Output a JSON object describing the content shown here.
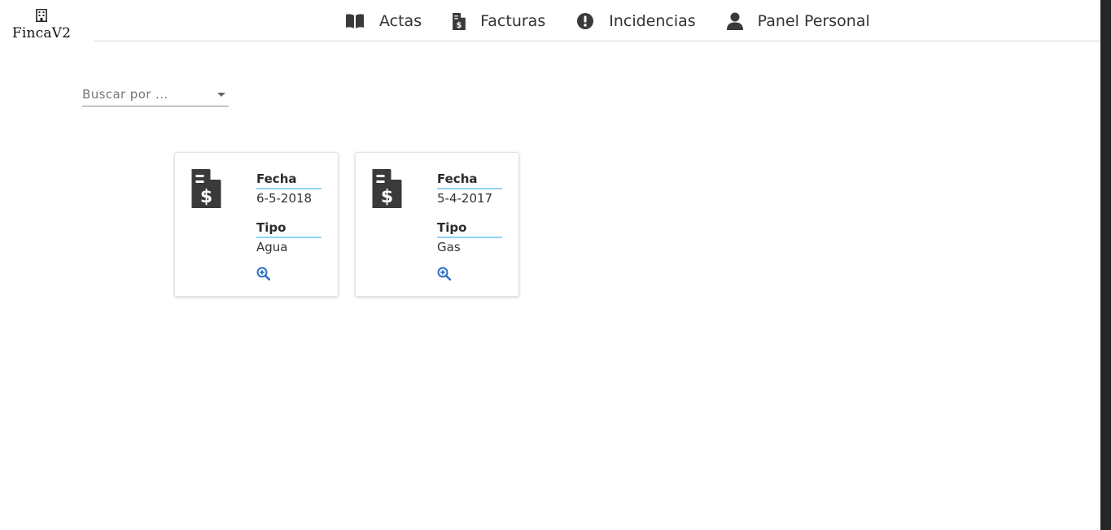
{
  "brand": {
    "name": "FincaV2",
    "icon": "building-icon"
  },
  "nav": {
    "items": [
      {
        "label": "Actas",
        "icon": "book-icon"
      },
      {
        "label": "Facturas",
        "icon": "invoice-file-icon"
      },
      {
        "label": "Incidencias",
        "icon": "exclamation-circle-icon"
      },
      {
        "label": "Panel Personal",
        "icon": "user-icon"
      }
    ]
  },
  "search": {
    "placeholder": "Buscar por ..."
  },
  "cards": [
    {
      "icon": "invoice-file-icon",
      "fecha_label": "Fecha",
      "fecha": "6-5-2018",
      "tipo_label": "Tipo",
      "tipo": "Agua",
      "action_icon": "zoom-in-icon"
    },
    {
      "icon": "invoice-file-icon",
      "fecha_label": "Fecha",
      "fecha": "5-4-2017",
      "tipo_label": "Tipo",
      "tipo": "Gas",
      "action_icon": "zoom-in-icon"
    }
  ],
  "colors": {
    "accent_underline": "#8fd3f4",
    "icon_dark": "#3a3a3a",
    "zoom_blue": "#2f6fc4"
  }
}
